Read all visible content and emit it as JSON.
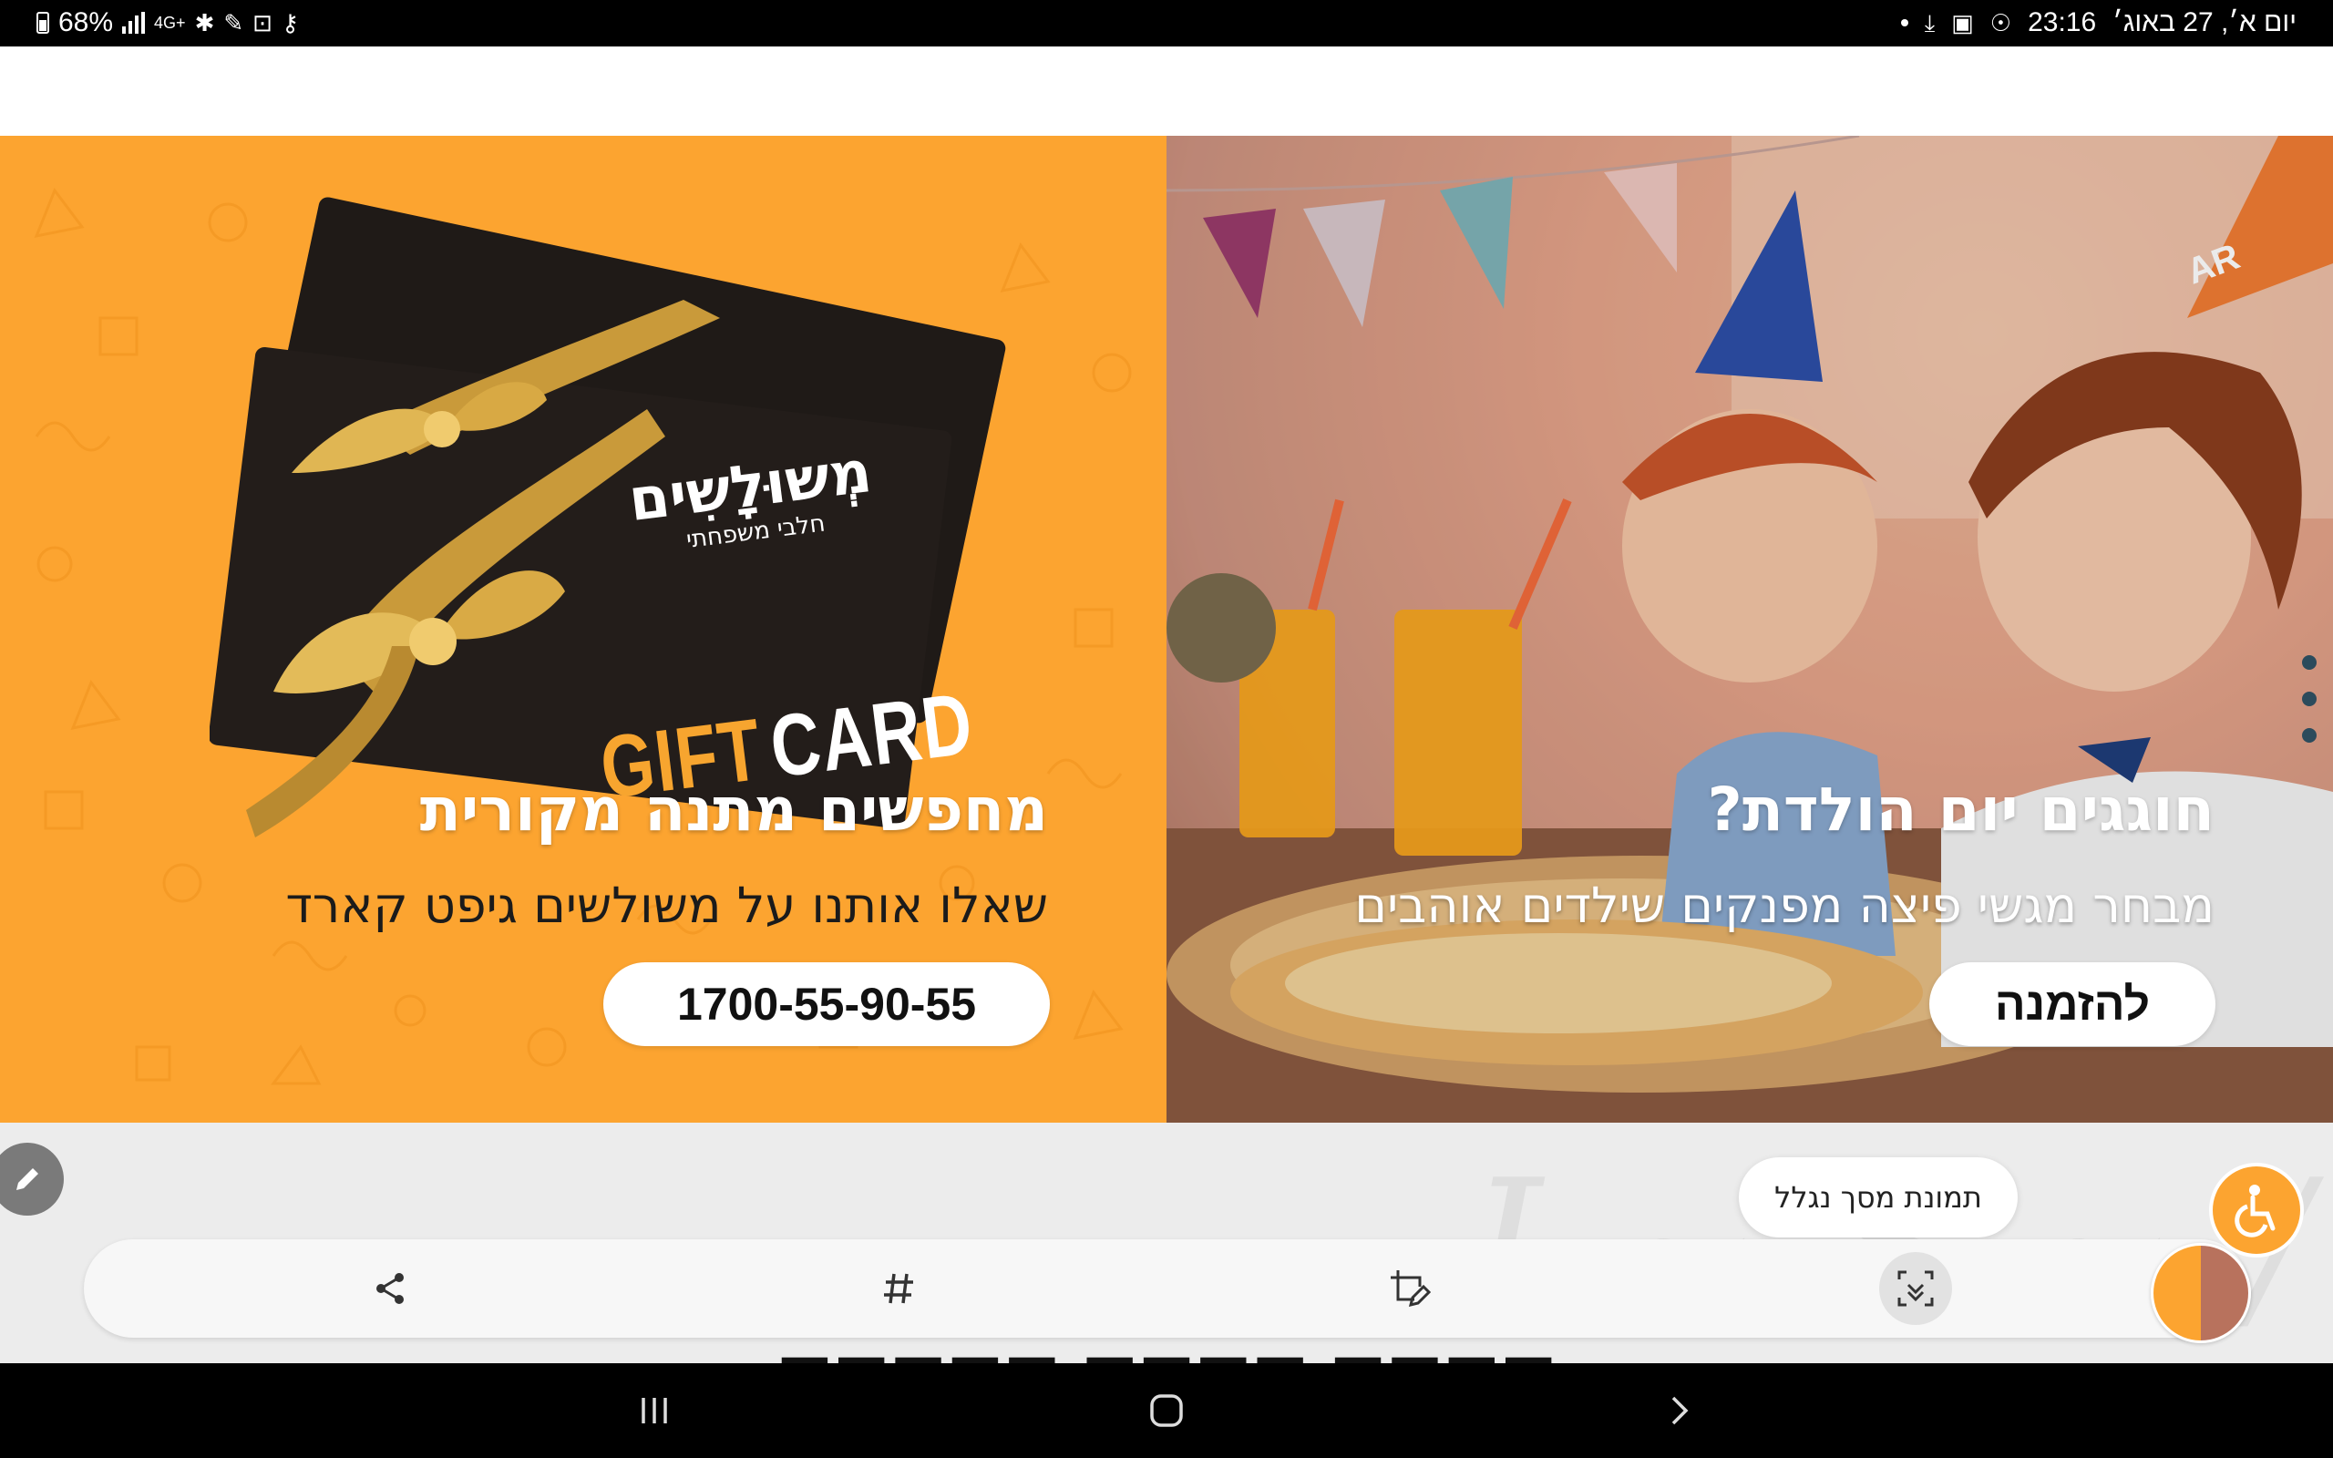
{
  "status_bar": {
    "battery": "68%",
    "network": "4G+",
    "time": "23:16",
    "date": "יום א׳, 27 באוג׳"
  },
  "banners": {
    "gift": {
      "headline": "מחפשים מתנה מקורית",
      "subline": "שאלו אותנו על משולשים גיפט קארד",
      "button": "1700-55-90-55",
      "card_brand": "מְשוּלָשִים",
      "card_tagline": "חלבי משפחתי",
      "card_gift": "GIFT",
      "card_card": "CARD"
    },
    "birthday": {
      "headline": "חוגגים יום הולדת?",
      "subline": "מבחר מגשי פיצה מפנקים שילדים אוהבים",
      "button": "להזמנה",
      "hat_text": "AR"
    }
  },
  "screenshot_toast": "תמונת מסך נגלל",
  "toolbar": {
    "icons": [
      "share-icon",
      "hashtag-icon",
      "crop-edit-icon",
      "scroll-capture-icon"
    ]
  },
  "colors": {
    "orange": "#fca430",
    "black": "#000000",
    "toolbar_bg": "#f7f7f7"
  }
}
